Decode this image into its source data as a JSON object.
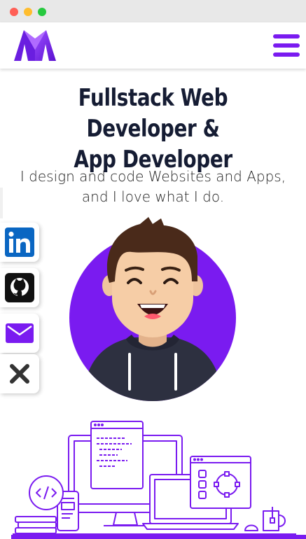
{
  "window": {
    "controls": [
      "close",
      "minimize",
      "maximize"
    ],
    "colors": {
      "close": "#ff5f56",
      "minimize": "#ffbd2e",
      "maximize": "#27c93f"
    }
  },
  "navbar": {
    "logo_icon": "m-logo-icon",
    "menu_icon": "hamburger-menu-icon"
  },
  "hero": {
    "title_line1": "Fullstack Web Developer &",
    "title_line2": "App Developer",
    "subtitle_line1": "I design and code Websites and Apps,",
    "subtitle_line2": "and I love what I do."
  },
  "social_links": [
    {
      "name": "LinkedIn",
      "icon": "linkedin-icon"
    },
    {
      "name": "GitHub",
      "icon": "github-icon"
    },
    {
      "name": "Email",
      "icon": "mail-icon"
    },
    {
      "name": "Close",
      "icon": "close-icon"
    }
  ],
  "illustrations": {
    "avatar": "developer-avatar-illustration",
    "devices": "devices-illustration"
  },
  "colors": {
    "accent": "#7a1bf0",
    "title": "#151c33",
    "linkedin": "#0a66c2",
    "github": "#111111"
  }
}
